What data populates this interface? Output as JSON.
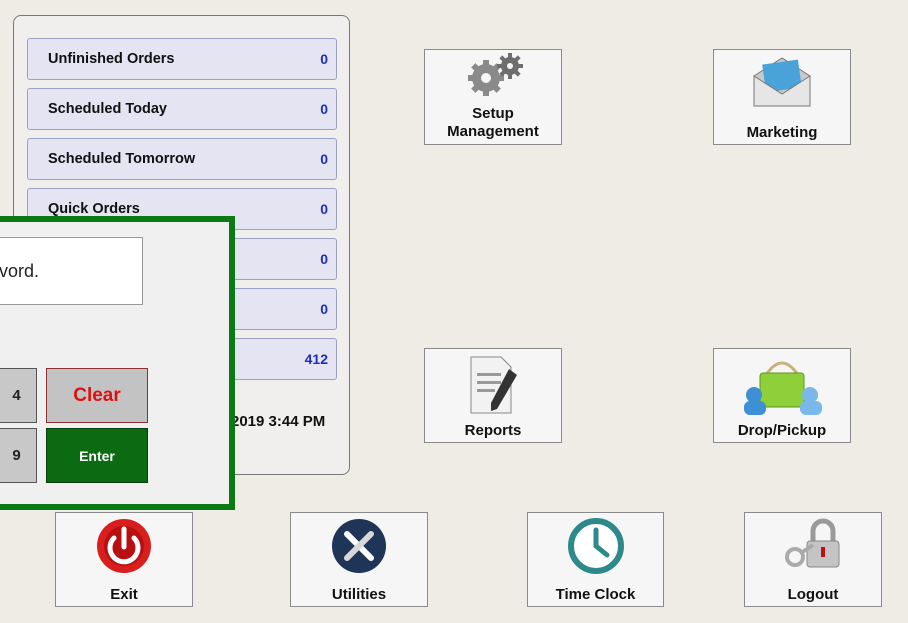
{
  "stats": [
    {
      "label": "Unfinished Orders",
      "value": "0"
    },
    {
      "label": "Scheduled Today",
      "value": "0"
    },
    {
      "label": "Scheduled Tomorrow",
      "value": "0"
    },
    {
      "label": "Quick Orders",
      "value": "0"
    },
    {
      "label": "",
      "value": "0"
    },
    {
      "label": "",
      "value": "0"
    },
    {
      "label": "",
      "value": "412"
    }
  ],
  "datetime": "2019 3:44 PM",
  "tiles": {
    "setup": {
      "line1": "Setup",
      "line2": "Management",
      "icon": "gears-icon"
    },
    "marketing": {
      "label": "Marketing",
      "icon": "envelope-icon"
    },
    "reports": {
      "label": "Reports",
      "icon": "document-pen-icon"
    },
    "drop_pickup": {
      "label": "Drop/Pickup",
      "icon": "basket-users-icon"
    },
    "exit": {
      "label": "Exit",
      "icon": "power-icon"
    },
    "utilities": {
      "label": "Utilities",
      "icon": "tools-icon"
    },
    "time_clock": {
      "label": "Time Clock",
      "icon": "clock-icon"
    },
    "logout": {
      "label": "Logout",
      "icon": "lock-key-icon"
    }
  },
  "dialog": {
    "message": "vord.",
    "keys": {
      "k4": "4",
      "k9": "9",
      "clear": "Clear",
      "enter": "Enter"
    }
  },
  "colors": {
    "dialog_border": "#0c7a14",
    "enter_bg": "#0a6b12",
    "clear_text": "#e01010",
    "stat_value": "#1a2fc0"
  }
}
